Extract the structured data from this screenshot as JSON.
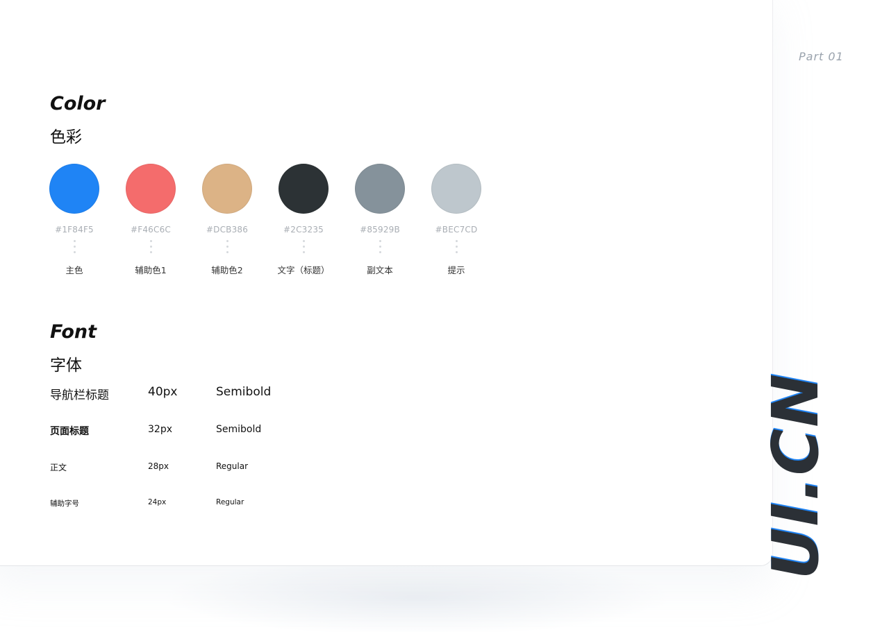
{
  "part_label": "Part 01",
  "brand_mark": "UI.CN",
  "color_section": {
    "title_en": "Color",
    "title_zh": "色彩",
    "swatches": [
      {
        "hex": "#1F84F5",
        "name": "主色",
        "color": "#1F84F5"
      },
      {
        "hex": "#F46C6C",
        "name": "辅助色1",
        "color": "#F46C6C"
      },
      {
        "hex": "#DCB386",
        "name": "辅助色2",
        "color": "#DCB386"
      },
      {
        "hex": "#2C3235",
        "name": "文字（标题）",
        "color": "#2C3235"
      },
      {
        "hex": "#85929B",
        "name": "副文本",
        "color": "#85929B"
      },
      {
        "hex": "#BEC7CD",
        "name": "提示",
        "color": "#BEC7CD"
      }
    ]
  },
  "font_section": {
    "title_en": "Font",
    "title_zh": "字体",
    "rows": [
      {
        "label": "导航栏标题",
        "size": "40px",
        "weight": "Semibold"
      },
      {
        "label": "页面标题",
        "size": "32px",
        "weight": "Semibold"
      },
      {
        "label": "正文",
        "size": "28px",
        "weight": "Regular"
      },
      {
        "label": "辅助字号",
        "size": "24px",
        "weight": "Regular"
      }
    ]
  }
}
